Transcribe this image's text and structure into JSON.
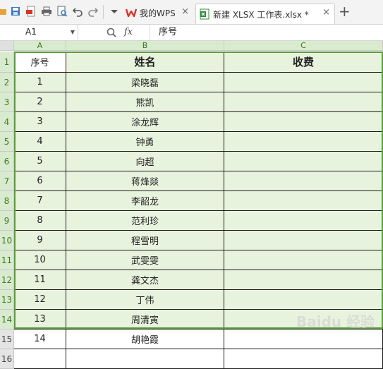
{
  "colors": {
    "selection_fill": "#e8f3de",
    "selection_border": "#5a9e3a",
    "header_selected": "#d9ebcf",
    "wps_red": "#d9342b",
    "xlsx_green": "#2e8b3a"
  },
  "toolbar": {
    "icons": [
      "folder-icon",
      "save-icon",
      "export-pdf-icon",
      "print-icon",
      "print-preview-icon",
      "undo-icon",
      "redo-icon",
      "dropdown-icon"
    ]
  },
  "tabs": [
    {
      "label": "我的WPS",
      "icon": "wps-logo-icon",
      "close": "×"
    },
    {
      "label": "新建 XLSX 工作表.xlsx *",
      "icon": "xlsx-file-icon",
      "close": "×"
    }
  ],
  "new_tab_label": "+",
  "formula_bar": {
    "name_box": "A1",
    "fx_label": "fx",
    "content": "序号"
  },
  "columns": [
    "A",
    "B",
    "C"
  ],
  "row_numbers": [
    "1",
    "2",
    "3",
    "4",
    "5",
    "6",
    "7",
    "8",
    "9",
    "10",
    "11",
    "12",
    "13",
    "14",
    "15",
    "16"
  ],
  "table": {
    "headers": [
      "序号",
      "姓名",
      "收费"
    ],
    "rows": [
      {
        "no": "1",
        "name": "梁晓磊",
        "fee": ""
      },
      {
        "no": "2",
        "name": "熊凯",
        "fee": ""
      },
      {
        "no": "3",
        "name": "涂龙辉",
        "fee": ""
      },
      {
        "no": "4",
        "name": "钟勇",
        "fee": ""
      },
      {
        "no": "5",
        "name": "向超",
        "fee": ""
      },
      {
        "no": "6",
        "name": "蒋烽燚",
        "fee": ""
      },
      {
        "no": "7",
        "name": "李韶龙",
        "fee": ""
      },
      {
        "no": "8",
        "name": "范利珍",
        "fee": ""
      },
      {
        "no": "9",
        "name": "程雪明",
        "fee": ""
      },
      {
        "no": "10",
        "name": "武雯雯",
        "fee": ""
      },
      {
        "no": "11",
        "name": "龚文杰",
        "fee": ""
      },
      {
        "no": "12",
        "name": "丁伟",
        "fee": ""
      },
      {
        "no": "13",
        "name": "周清寅",
        "fee": ""
      },
      {
        "no": "14",
        "name": "胡艳霞",
        "fee": ""
      },
      {
        "no": "",
        "name": "",
        "fee": ""
      }
    ]
  }
}
